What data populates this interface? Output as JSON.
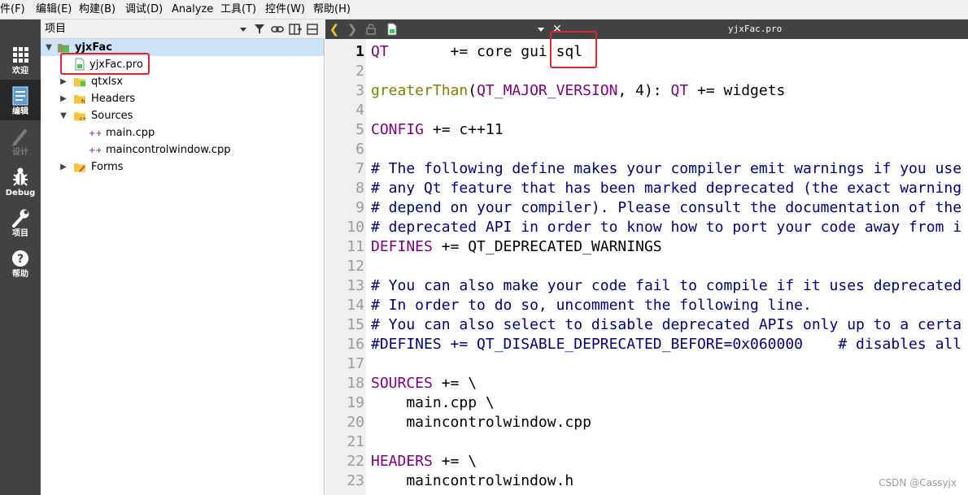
{
  "menubar": {
    "items": [
      "件(F)",
      "编辑(E)",
      "构建(B)",
      "调试(D)",
      "Analyze",
      "工具(T)",
      "控件(W)",
      "帮助(H)"
    ]
  },
  "modebar": {
    "modes": [
      {
        "label": "欢迎",
        "icon": "grid-icon"
      },
      {
        "label": "编辑",
        "icon": "document-icon"
      },
      {
        "label": "设计",
        "icon": "pencil-icon"
      },
      {
        "label": "Debug",
        "icon": "bug-icon"
      },
      {
        "label": "项目",
        "icon": "wrench-icon"
      },
      {
        "label": "帮助",
        "icon": "help-icon"
      }
    ]
  },
  "project_panel": {
    "title": "项目",
    "tree": [
      {
        "label": "yjxFac",
        "icon": "qt-project-folder-icon"
      },
      {
        "label": "yjxFac.pro",
        "icon": "pro-file-icon"
      },
      {
        "label": "qtxlsx",
        "icon": "folder-icon"
      },
      {
        "label": "Headers",
        "icon": "headers-folder-icon"
      },
      {
        "label": "Sources",
        "icon": "sources-folder-icon"
      },
      {
        "label": "main.cpp",
        "icon": "cpp-file-icon"
      },
      {
        "label": "maincontrolwindow.cpp",
        "icon": "cpp-file-icon"
      },
      {
        "label": "Forms",
        "icon": "forms-folder-icon"
      }
    ]
  },
  "editor": {
    "document_name": "yjxFac.pro",
    "line_numbers": [
      "1",
      "2",
      "3",
      "4",
      "5",
      "6",
      "7",
      "8",
      "9",
      "10",
      "11",
      "12",
      "13",
      "14",
      "15",
      "16",
      "17",
      "18",
      "19",
      "20",
      "21",
      "22",
      "23"
    ],
    "lines": [
      [
        {
          "t": "QT",
          "c": "kw"
        },
        {
          "t": "       += core gui ",
          "c": ""
        },
        {
          "t": "sql",
          "c": ""
        }
      ],
      [],
      [
        {
          "t": "greaterThan",
          "c": "fn"
        },
        {
          "t": "(",
          "c": ""
        },
        {
          "t": "QT_MAJOR_VERSION",
          "c": "kw"
        },
        {
          "t": ", 4): ",
          "c": ""
        },
        {
          "t": "QT",
          "c": "kw"
        },
        {
          "t": " += widgets",
          "c": ""
        }
      ],
      [],
      [
        {
          "t": "CONFIG",
          "c": "kw"
        },
        {
          "t": " += c++11",
          "c": ""
        }
      ],
      [],
      [
        {
          "t": "# The following define makes your compiler emit warnings if you use",
          "c": "cm"
        }
      ],
      [
        {
          "t": "# any Qt feature that has been marked deprecated (the exact warning",
          "c": "cm"
        }
      ],
      [
        {
          "t": "# depend on your compiler). Please consult the documentation of the",
          "c": "cm"
        }
      ],
      [
        {
          "t": "# deprecated API in order to know how to port your code away from i",
          "c": "cm"
        }
      ],
      [
        {
          "t": "DEFINES",
          "c": "kw"
        },
        {
          "t": " += QT_DEPRECATED_WARNINGS",
          "c": ""
        }
      ],
      [],
      [
        {
          "t": "# You can also make your code fail to compile if it uses deprecated",
          "c": "cm"
        }
      ],
      [
        {
          "t": "# In order to do so, uncomment the following line.",
          "c": "cm"
        }
      ],
      [
        {
          "t": "# You can also select to disable deprecated APIs only up to a certa",
          "c": "cm"
        }
      ],
      [
        {
          "t": "#DEFINES += QT_DISABLE_DEPRECATED_BEFORE=0x060000    # disables all",
          "c": "cm"
        }
      ],
      [],
      [
        {
          "t": "SOURCES",
          "c": "kw"
        },
        {
          "t": " += \\",
          "c": ""
        }
      ],
      [
        {
          "t": "    main.cpp \\",
          "c": ""
        }
      ],
      [
        {
          "t": "    maincontrolwindow.cpp",
          "c": ""
        }
      ],
      [],
      [
        {
          "t": "HEADERS",
          "c": "kw"
        },
        {
          "t": " += \\",
          "c": ""
        }
      ],
      [
        {
          "t": "    maincontrolwindow.h",
          "c": ""
        }
      ]
    ]
  },
  "watermark": "CSDN @Cassyjx",
  "colors": {
    "highlight_box": "#e0262c",
    "modebar_bg": "#404244",
    "selection": "#cde3f7"
  }
}
